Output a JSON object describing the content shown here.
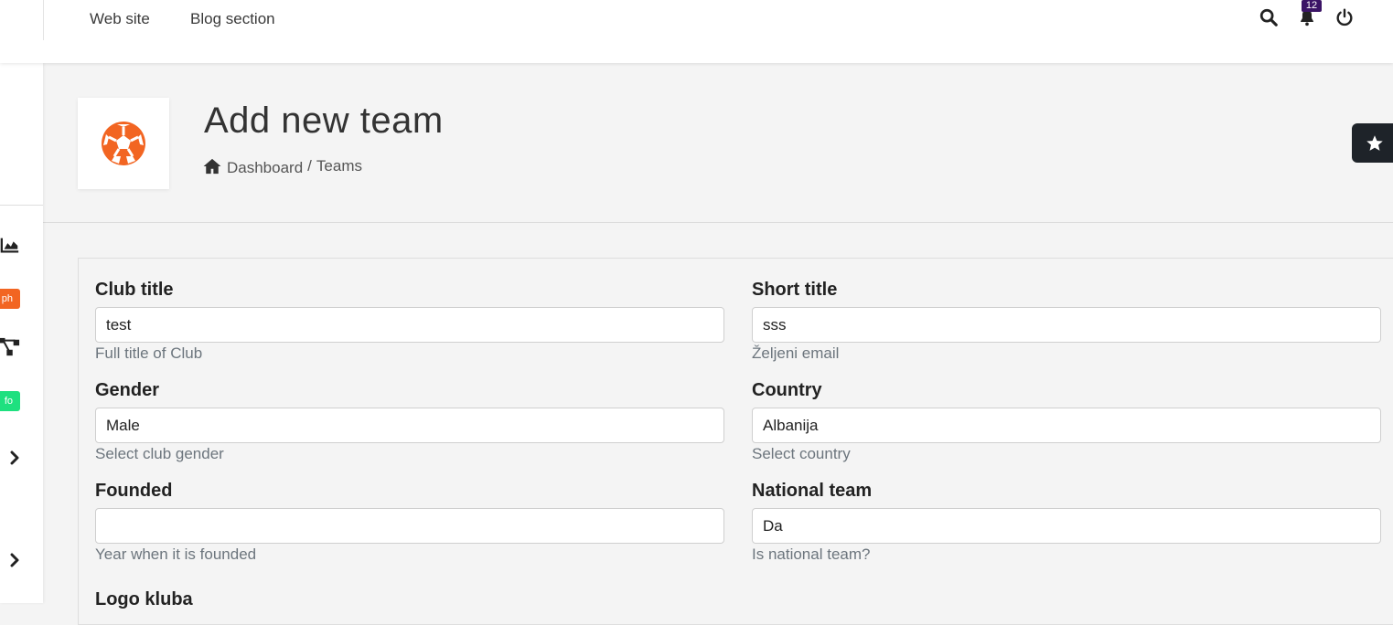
{
  "topnav": {
    "links": [
      "Web site",
      "Blog section"
    ],
    "notification_count": "12",
    "icons": [
      "search-icon",
      "bell-icon",
      "power-icon"
    ]
  },
  "sidebar": {
    "badges": [
      "ph",
      "fo"
    ],
    "icons": [
      "area-chart-icon",
      "sitemap-icon",
      "chevron-right-icon",
      "chevron-right-icon"
    ]
  },
  "header": {
    "title": "Add new team",
    "logo_icon": "soccer-ball-icon",
    "breadcrumb": {
      "home": "Dashboard",
      "separator": "/",
      "current": "Teams"
    }
  },
  "form": {
    "club_title": {
      "label": "Club title",
      "value": "test",
      "help": "Full title of Club"
    },
    "short_title": {
      "label": "Short title",
      "value": "sss",
      "help": "Željeni email"
    },
    "gender": {
      "label": "Gender",
      "value": "Male",
      "help": "Select club gender"
    },
    "country": {
      "label": "Country",
      "value": "Albanija",
      "help": "Select country"
    },
    "founded": {
      "label": "Founded",
      "value": "",
      "help": "Year when it is founded"
    },
    "national_team": {
      "label": "National team",
      "value": "Da",
      "help": "Is national team?"
    },
    "logo": {
      "label": "Logo kluba"
    }
  },
  "colors": {
    "accent_orange": "#f26522",
    "badge_purple": "#3b1466",
    "badge_green": "#1ee07f",
    "fav_dark": "#1e2329"
  }
}
